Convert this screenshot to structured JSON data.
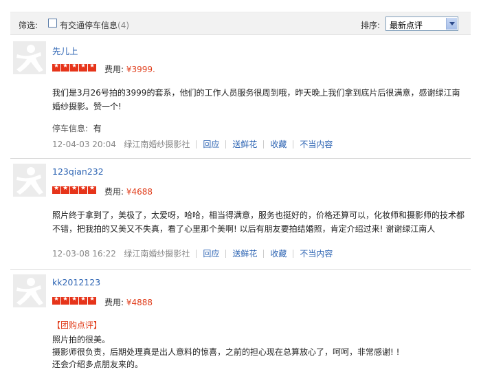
{
  "filter": {
    "label": "筛选:",
    "checkbox_label": "有交通停车信息",
    "checkbox_count": "(4)",
    "sort_label": "排序:",
    "sort_value": "最新点评"
  },
  "reviews": [
    {
      "username": "先儿上",
      "rating": 5,
      "cost_label": "费用:",
      "cost": "¥3999.",
      "content": "我们是3月26号拍的3999的套系，他们的工作人员服务很周到哦，昨天晚上我们拿到底片后很满意，感谢绿江南婚纱摄影。赞一个!",
      "parking_label": "停车信息:",
      "parking_value": "有",
      "date": "12-04-03 20:04",
      "shop": "绿江南婚纱摄影社",
      "actions": [
        "回应",
        "送鲜花",
        "收藏",
        "不当内容"
      ]
    },
    {
      "username": "123qian232",
      "rating": 5,
      "cost_label": "费用:",
      "cost": "¥4688",
      "content": "照片终于拿到了，美极了，太爱呀，哈哈，相当得满意，服务也挺好的，价格还算可以，化妆师和摄影师的技术都不错，把我拍的又美又不失真，看了心里那个美啊! 以后有朋友要拍结婚照，肯定介绍过来! 谢谢绿江南人",
      "date": "12-03-08 16:22",
      "shop": "绿江南婚纱摄影社",
      "actions": [
        "回应",
        "送鲜花",
        "收藏",
        "不当内容"
      ]
    },
    {
      "username": "kk2012123",
      "rating": 5,
      "cost_label": "费用:",
      "cost": "¥4888",
      "tag": "【团购点评】",
      "lines": [
        "照片拍的很美。",
        "摄影师很负责，后期处理真是出人意料的惊喜，之前的担心现在总算放心了，呵呵，非常感谢! !",
        "还会介绍多点朋友来的。"
      ]
    }
  ],
  "colors": {
    "link": "#2d64b3",
    "accent": "#e03c1a",
    "star": "#e6341a"
  }
}
